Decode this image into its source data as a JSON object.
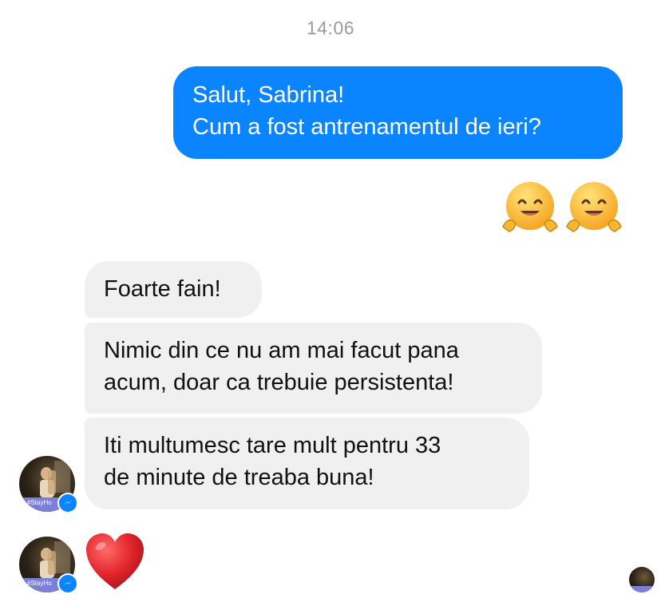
{
  "conversation": {
    "timestamp": "14:06",
    "outgoing_message": "Salut, Sabrina!\nCum a fost antrenamentul de ieri?",
    "outgoing_emoji": [
      "hugging-face-emoji",
      "hugging-face-emoji"
    ],
    "incoming_messages": [
      "Foarte fain!",
      "Nimic din ce nu am mai facut pana\nacum, doar ca trebuie persistenta!",
      "Iti multumesc tare mult pentru 33\nde minute de treaba buna!"
    ],
    "incoming_reaction": "red-heart-emoji",
    "avatar_banner_text": "#StayHo"
  },
  "colors": {
    "outgoing_bubble": "#0a84ff",
    "incoming_bubble": "#f0f0f0",
    "timestamp_text": "#9a9aa0",
    "avatar_banner": "#7b7fd8",
    "messenger_badge": "#0a84ff",
    "heart": "#e0242b"
  }
}
